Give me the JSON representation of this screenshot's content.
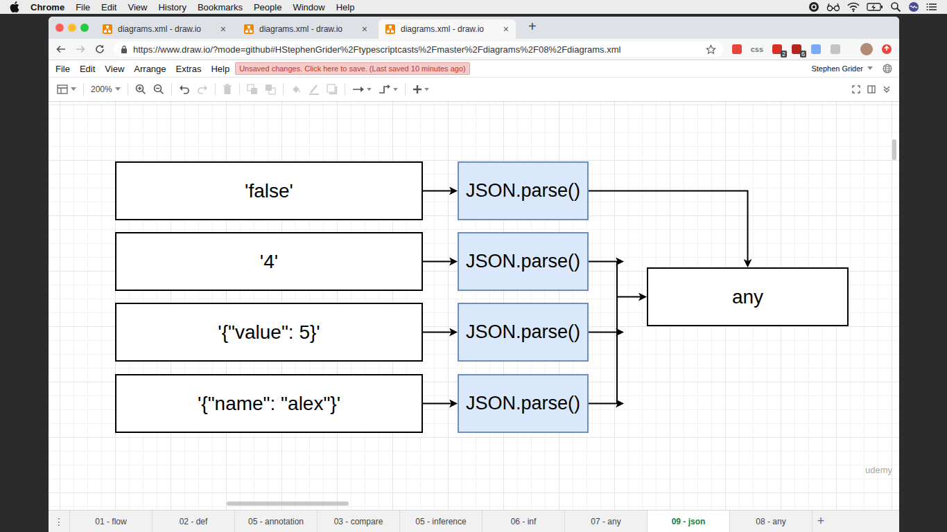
{
  "menubar": {
    "app": "Chrome",
    "items": [
      "File",
      "Edit",
      "View",
      "History",
      "Bookmarks",
      "People",
      "Window",
      "Help"
    ]
  },
  "browser": {
    "tabs": [
      {
        "title": "diagrams.xml - draw.io",
        "close": "×",
        "selected": false
      },
      {
        "title": "diagrams.xml - draw.io",
        "close": "×",
        "selected": false
      },
      {
        "title": "diagrams.xml - draw.io",
        "close": "×",
        "selected": true
      }
    ],
    "new_tab": "+",
    "url": "https://www.draw.io/?mode=github#HStephenGrider%2Ftypescriptcasts%2Fmaster%2Fdiagrams%2F08%2Fdiagrams.xml",
    "extensions": [
      {
        "text": "",
        "badge": "",
        "color": "#e8453c"
      },
      {
        "text": "css",
        "badge": "",
        "color": "#777777"
      },
      {
        "text": "",
        "badge": "2",
        "color": "#d93025"
      },
      {
        "text": "",
        "badge": "6",
        "color": "#b3261e"
      },
      {
        "text": "",
        "badge": "",
        "color": "#7baaf7"
      },
      {
        "text": "",
        "badge": "",
        "color": "#c4c4c4"
      }
    ]
  },
  "app": {
    "menu": [
      "File",
      "Edit",
      "View",
      "Arrange",
      "Extras",
      "Help"
    ],
    "notice": "Unsaved changes. Click here to save. (Last saved 10 minutes ago)",
    "user": "Stephen Grider"
  },
  "toolbar": {
    "zoom": "200%",
    "tools": [
      {
        "kind": "zoom-in",
        "disabled": false
      },
      {
        "kind": "zoom-out",
        "disabled": false
      },
      {
        "kind": "undo",
        "disabled": false
      },
      {
        "kind": "redo",
        "disabled": true
      },
      {
        "kind": "delete",
        "disabled": true
      },
      {
        "kind": "front",
        "disabled": true
      },
      {
        "kind": "back",
        "disabled": true
      },
      {
        "kind": "fill",
        "disabled": true
      },
      {
        "kind": "line",
        "disabled": true
      },
      {
        "kind": "shadow",
        "disabled": true
      },
      {
        "kind": "connection",
        "disabled": false
      },
      {
        "kind": "waypoints",
        "disabled": false
      },
      {
        "kind": "insert",
        "disabled": false
      }
    ]
  },
  "diagram": {
    "rows": [
      {
        "input": "'false'",
        "function": "JSON.parse()"
      },
      {
        "input": "'4'",
        "function": "JSON.parse()"
      },
      {
        "input": "'{\"value\": 5}'",
        "function": "JSON.parse()"
      },
      {
        "input": "'{\"name\": \"alex\"}'",
        "function": "JSON.parse()"
      }
    ],
    "output": "any"
  },
  "pages": {
    "menu": "⋮",
    "tabs": [
      {
        "label": "01 - flow",
        "selected": false
      },
      {
        "label": "02 - def",
        "selected": false
      },
      {
        "label": "05 - annotation",
        "selected": false
      },
      {
        "label": "03 - compare",
        "selected": false
      },
      {
        "label": "05 - inference",
        "selected": false
      },
      {
        "label": "06 - inf",
        "selected": false
      },
      {
        "label": "07 - any",
        "selected": false
      },
      {
        "label": "09 - json",
        "selected": true
      },
      {
        "label": "08 - any",
        "selected": false
      }
    ],
    "add": "+"
  },
  "watermark": "udemy"
}
